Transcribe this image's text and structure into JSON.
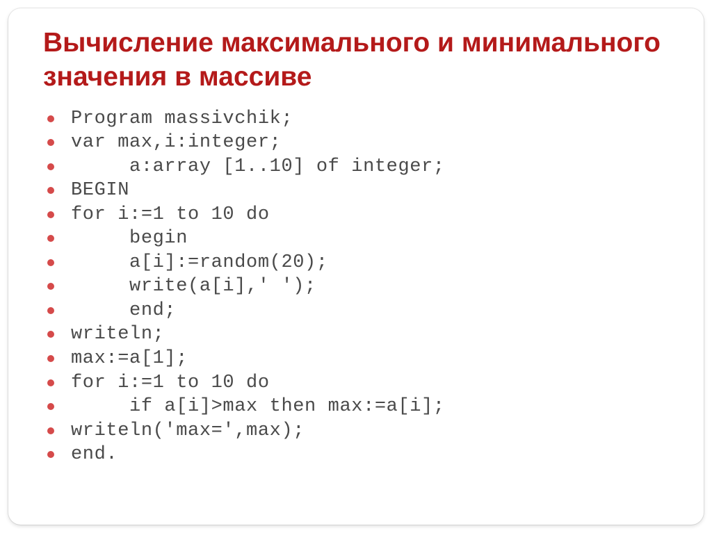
{
  "title": "Вычисление максимального и минимального значения в массиве",
  "code": {
    "l0": "Program massivchik;",
    "l1": "var max,i:integer;",
    "l2": "     a:array [1..10] of integer;",
    "l3": "BEGIN",
    "l4": "for i:=1 to 10 do",
    "l5": "     begin",
    "l6": "     a[i]:=random(20);",
    "l7": "     write(a[i],' ');",
    "l8": "     end;",
    "l9": "writeln;",
    "l10": "max:=a[1];",
    "l11": "for i:=1 to 10 do",
    "l12": "     if a[i]>max then max:=a[i];",
    "l13": "writeln('max=',max);",
    "l14": "end."
  }
}
